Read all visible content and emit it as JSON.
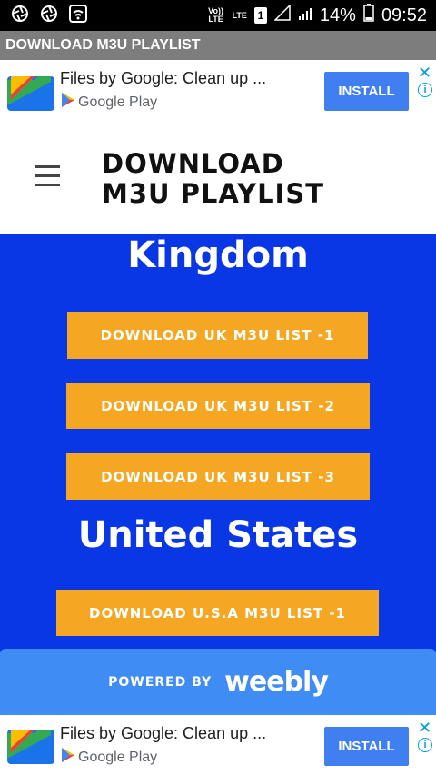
{
  "status_bar": {
    "lte_top": "Vo)) LTE",
    "lte_signal": "LTE",
    "sim": "1",
    "battery": "14%",
    "time": "09:52"
  },
  "app_bar": {
    "title": "DOWNLOAD M3U PLAYLIST"
  },
  "ad": {
    "title": "Files by Google: Clean up ...",
    "store": "Google Play",
    "install": "INSTALL",
    "close": "✕",
    "info": "i"
  },
  "site": {
    "title": "DOWNLOAD M3U PLAYLIST",
    "title_line1": "DOWNLOAD",
    "title_line2": "M3U PLAYLIST"
  },
  "content": {
    "heading_uk": "Kingdom",
    "heading_us": "United States",
    "buttons": [
      "DOWNLOAD UK M3U LIST -1",
      "DOWNLOAD UK M3U LIST -2",
      "DOWNLOAD UK M3U LIST -3",
      "DOWNLOAD U.S.A M3U LIST -1"
    ]
  },
  "footer": {
    "powered_by": "POWERED BY",
    "brand": "weebly"
  },
  "colors": {
    "background": "#0a37e6",
    "button": "#f5a623",
    "install": "#3f7ff0",
    "footer": "#3f8cf4"
  }
}
